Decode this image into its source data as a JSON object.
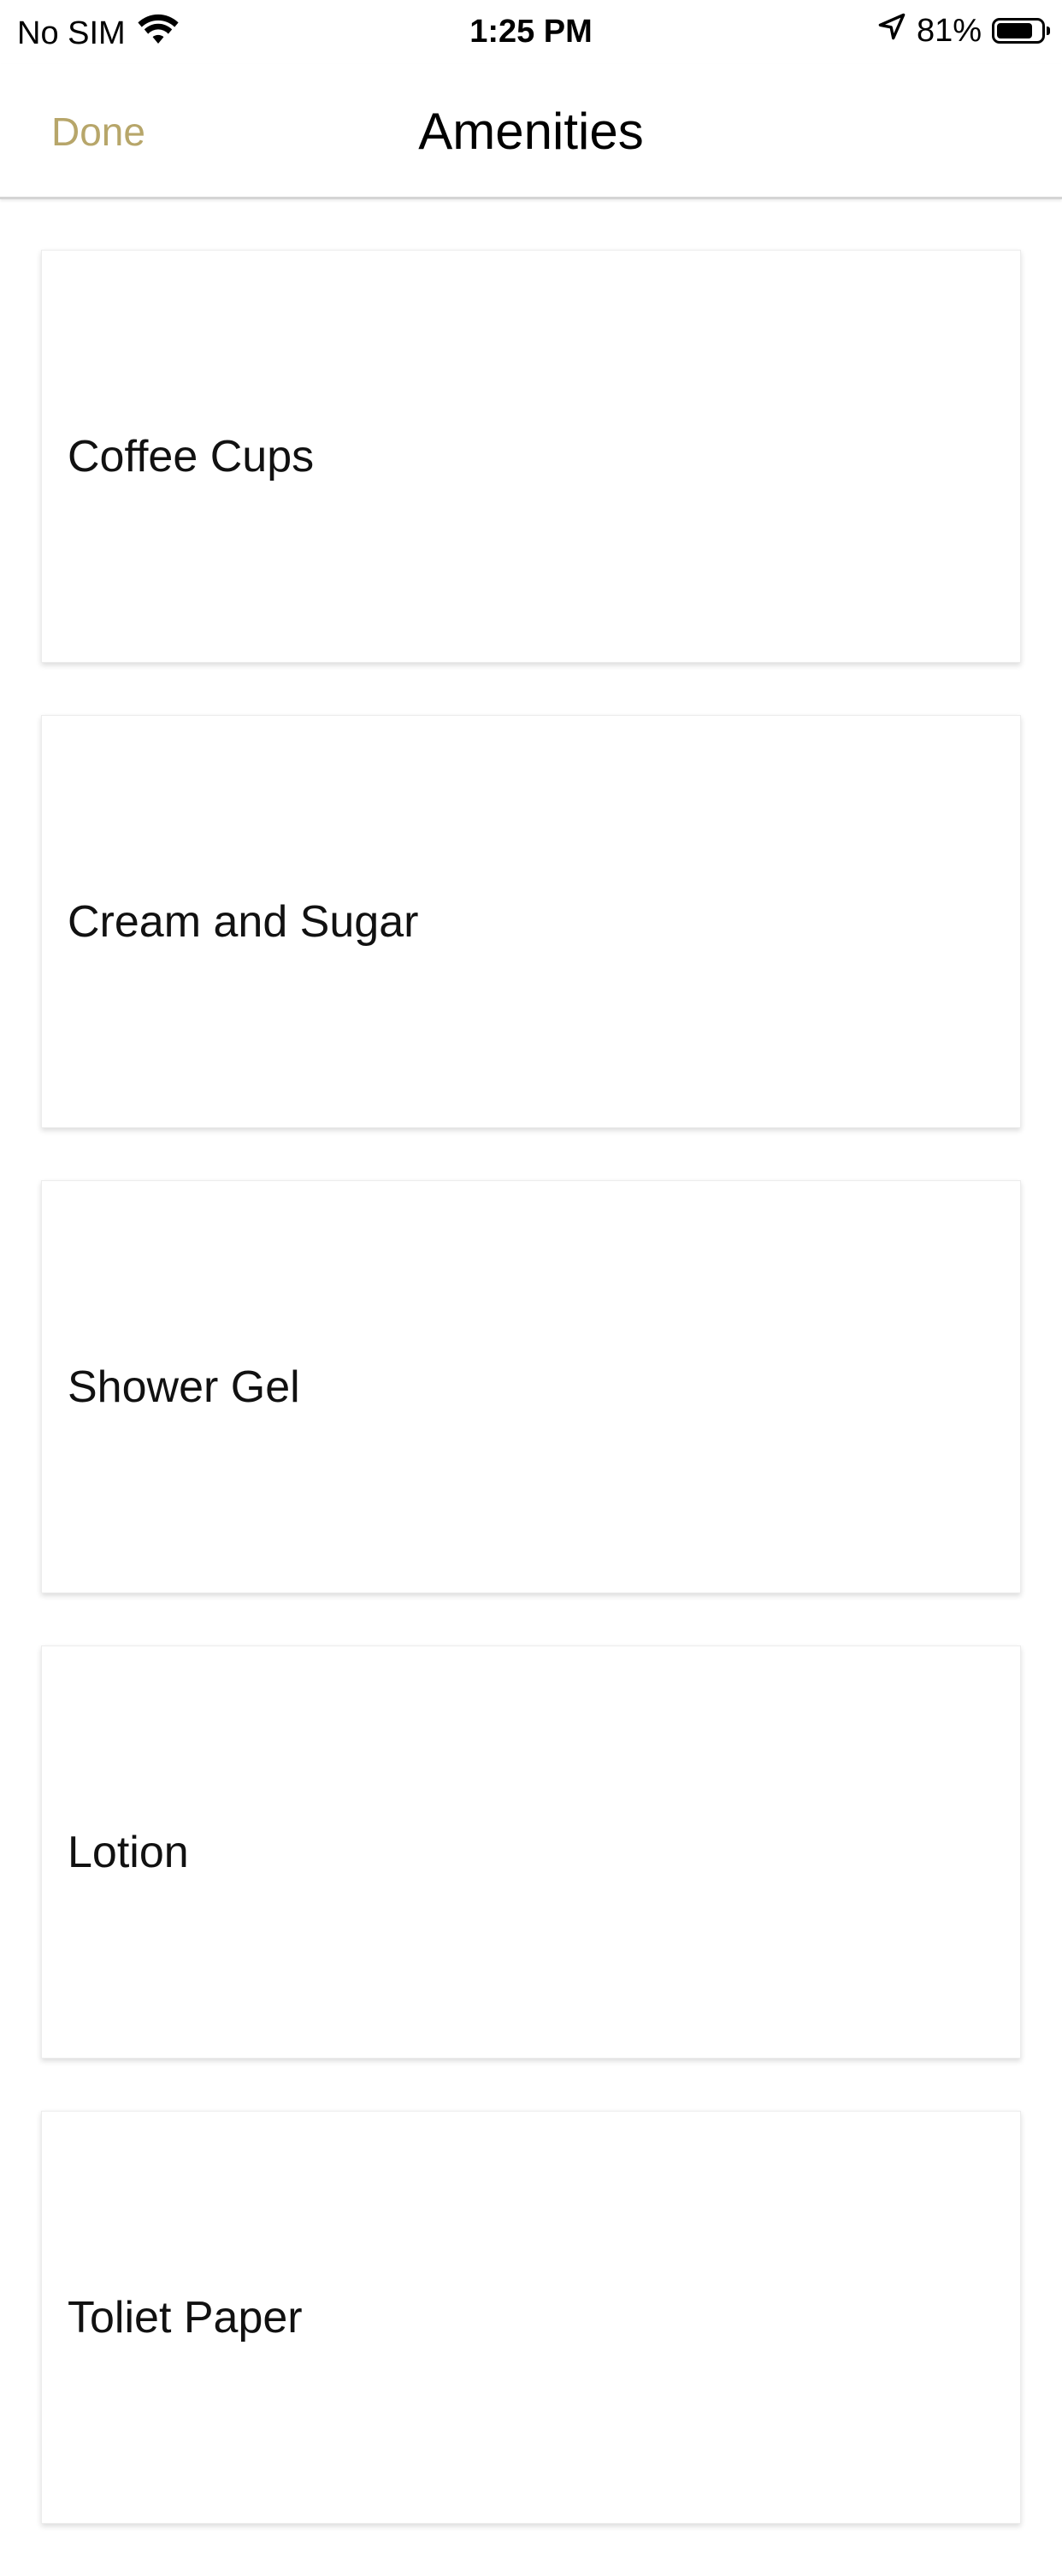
{
  "status_bar": {
    "carrier": "No SIM",
    "time": "1:25 PM",
    "battery": "81%",
    "battery_level": 0.81,
    "icons": [
      "wifi-icon",
      "location-arrow-icon",
      "battery-icon"
    ]
  },
  "nav": {
    "done_label": "Done",
    "title": "Amenities",
    "accent_color": "#b7a66a"
  },
  "amenities": [
    {
      "label": "Coffee Cups"
    },
    {
      "label": "Cream and Sugar"
    },
    {
      "label": "Shower Gel"
    },
    {
      "label": "Lotion"
    },
    {
      "label": "Toliet Paper"
    }
  ]
}
